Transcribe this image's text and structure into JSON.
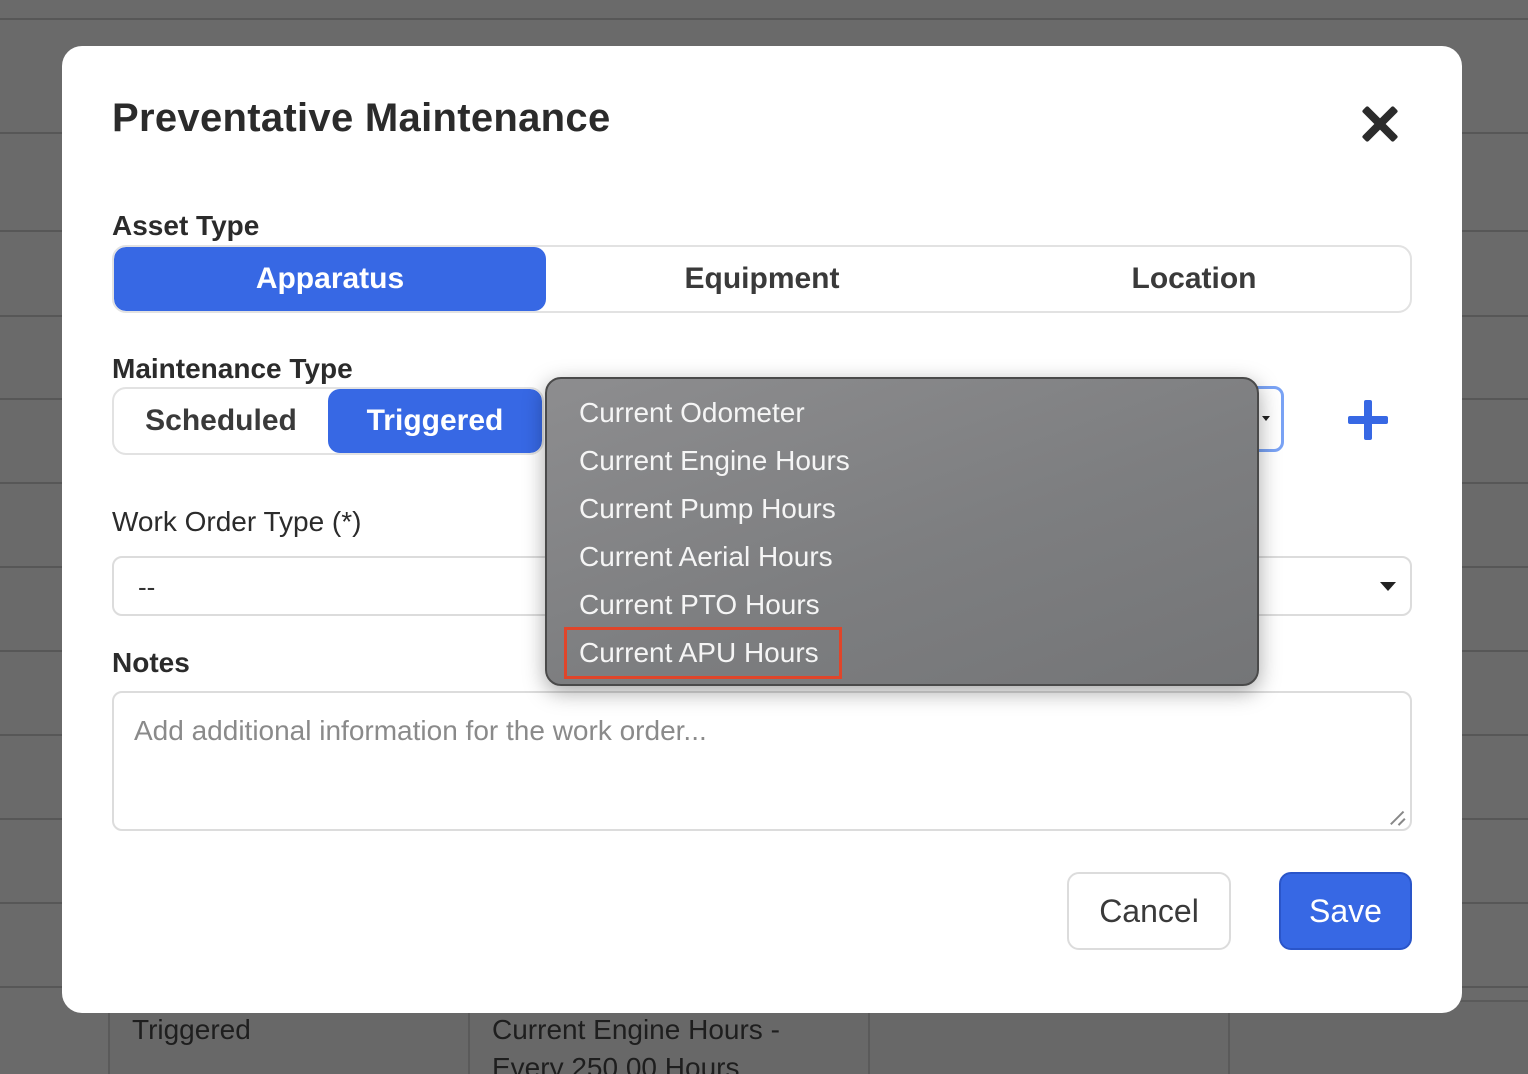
{
  "background": {
    "row": {
      "type": "Triggered",
      "trigger": "Current Engine Hours -",
      "trigger_line2": "Every 250.00 Hours"
    }
  },
  "modal": {
    "title": "Preventative Maintenance",
    "asset_type": {
      "label": "Asset Type",
      "options": [
        "Apparatus",
        "Equipment",
        "Location"
      ],
      "selected": "Apparatus"
    },
    "maintenance_type": {
      "label": "Maintenance Type",
      "options": [
        "Scheduled",
        "Triggered"
      ],
      "selected": "Triggered"
    },
    "work_order_type": {
      "label": "Work Order Type (*)",
      "value": "--"
    },
    "notes": {
      "label": "Notes",
      "placeholder": "Add additional information for the work order..."
    },
    "buttons": {
      "cancel": "Cancel",
      "save": "Save"
    }
  },
  "dropdown": {
    "items": [
      "Current Odometer",
      "Current Engine Hours",
      "Current Pump Hours",
      "Current Aerial Hours",
      "Current PTO Hours",
      "Current APU Hours"
    ],
    "highlighted": "Current APU Hours"
  },
  "colors": {
    "accent": "#3768e4",
    "highlight": "#e0452a"
  }
}
